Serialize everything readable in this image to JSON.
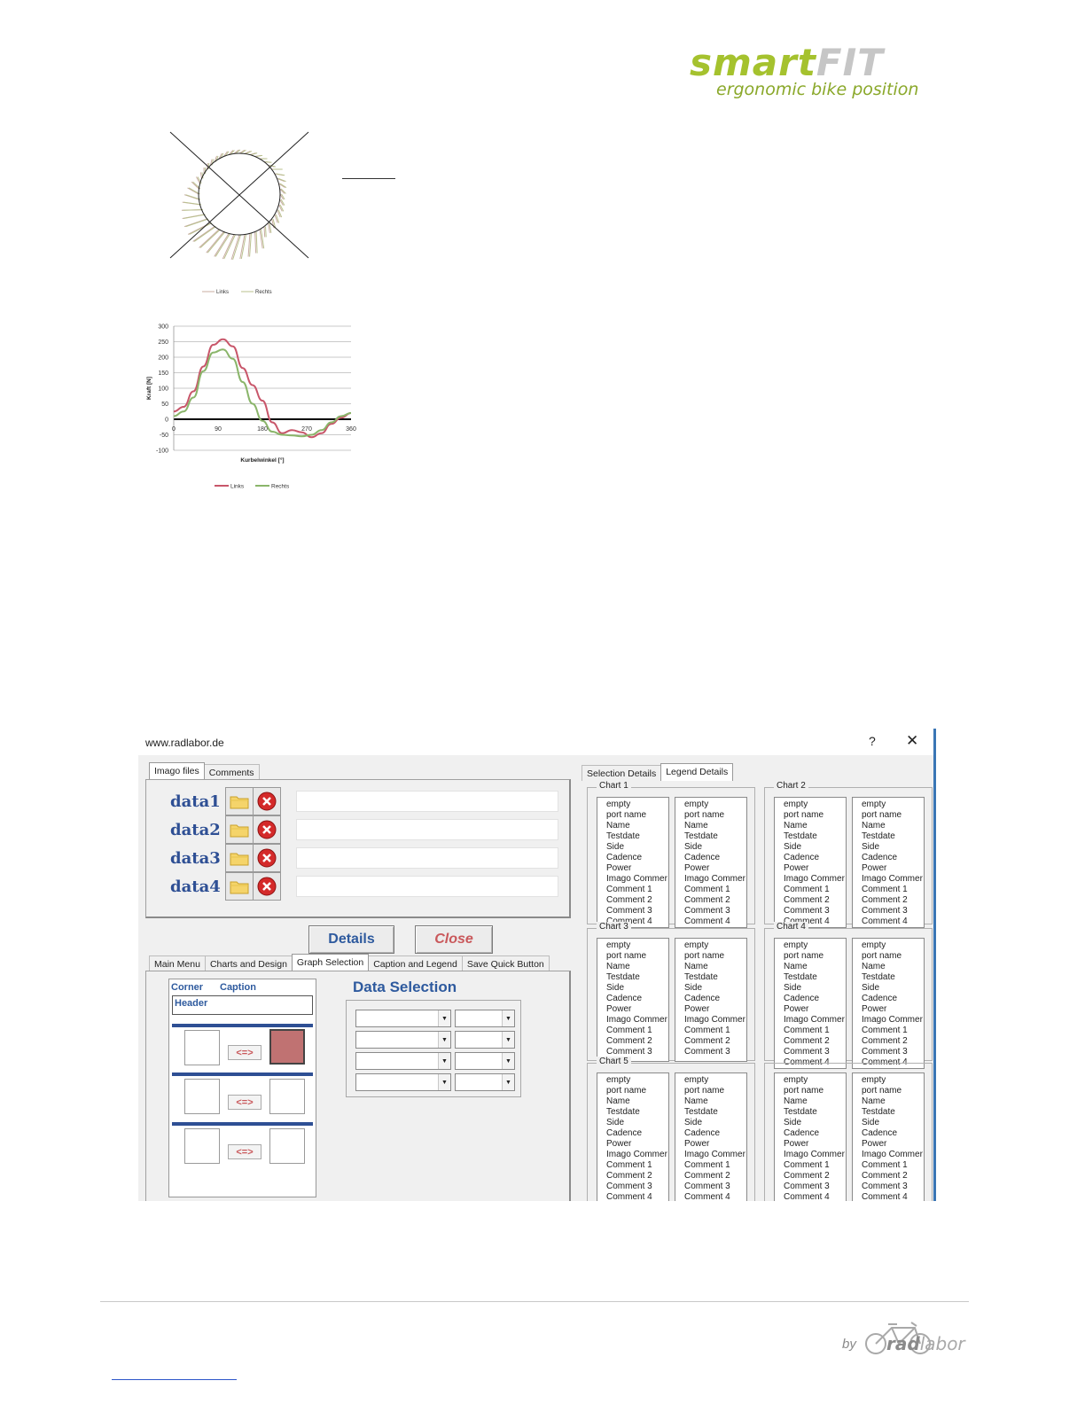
{
  "logo": {
    "brand_a": "smart",
    "brand_b": "FIT",
    "tagline": "ergonomic bike position"
  },
  "circle_chart": {
    "legend": [
      "Links",
      "Rechts"
    ],
    "colors": {
      "links": "#c8aca2",
      "rechts": "#b9c18e"
    }
  },
  "chart_data": {
    "type": "line",
    "xlabel": "Kurbelwinkel [°]",
    "ylabel": "Kraft [N]",
    "xlim": [
      0,
      360
    ],
    "ylim": [
      -100,
      300
    ],
    "x_ticks": [
      "0",
      "90",
      "180",
      "270",
      "360"
    ],
    "y_ticks": [
      "300",
      "250",
      "200",
      "150",
      "100",
      "50",
      "0",
      "-50",
      "-100"
    ],
    "grid": true,
    "legend_placement": "bottom",
    "x": [
      0,
      20,
      40,
      60,
      80,
      100,
      120,
      140,
      160,
      180,
      200,
      220,
      240,
      260,
      280,
      300,
      320,
      340,
      360
    ],
    "series": [
      {
        "name": "Links",
        "color": "#c8566a",
        "values": [
          25,
          40,
          90,
          170,
          240,
          258,
          235,
          165,
          110,
          60,
          -10,
          -45,
          -35,
          -42,
          -58,
          -45,
          -15,
          5,
          20
        ]
      },
      {
        "name": "Rechts",
        "color": "#8ab56a",
        "values": [
          10,
          25,
          70,
          155,
          215,
          225,
          195,
          120,
          50,
          -5,
          -40,
          -50,
          -52,
          -55,
          -50,
          -35,
          -10,
          10,
          20
        ]
      }
    ]
  },
  "dialog": {
    "title": "www.radlabor.de",
    "help": "?",
    "close": "✕",
    "top_tabs": [
      "Imago files",
      "Comments"
    ],
    "data_rows": [
      "data1",
      "data2",
      "data3",
      "data4"
    ],
    "details_label": "Details",
    "close_label": "Close",
    "bottom_tabs": [
      "Main Menu",
      "Charts and Design",
      "Graph Selection",
      "Caption and Legend",
      "Save Quick Button"
    ],
    "corner_label": "Corner",
    "caption_label": "Caption",
    "header_label": "Header",
    "swap_label": "<=>",
    "data_selection_title": "Data Selection",
    "right_tabs": [
      "Selection Details",
      "Legend Details"
    ],
    "charts": [
      "Chart 1",
      "Chart 2",
      "Chart 3",
      "Chart 4",
      "Chart 5",
      ""
    ],
    "list_items": [
      "empty",
      "port name",
      "Name",
      "Testdate",
      "Side",
      "Cadence",
      "Power",
      "Imago Commer",
      "Comment 1",
      "Comment 2",
      "Comment 3",
      "Comment 4"
    ]
  },
  "footer": {
    "by": "by",
    "brand_a": "rad",
    "brand_b": "labor"
  }
}
